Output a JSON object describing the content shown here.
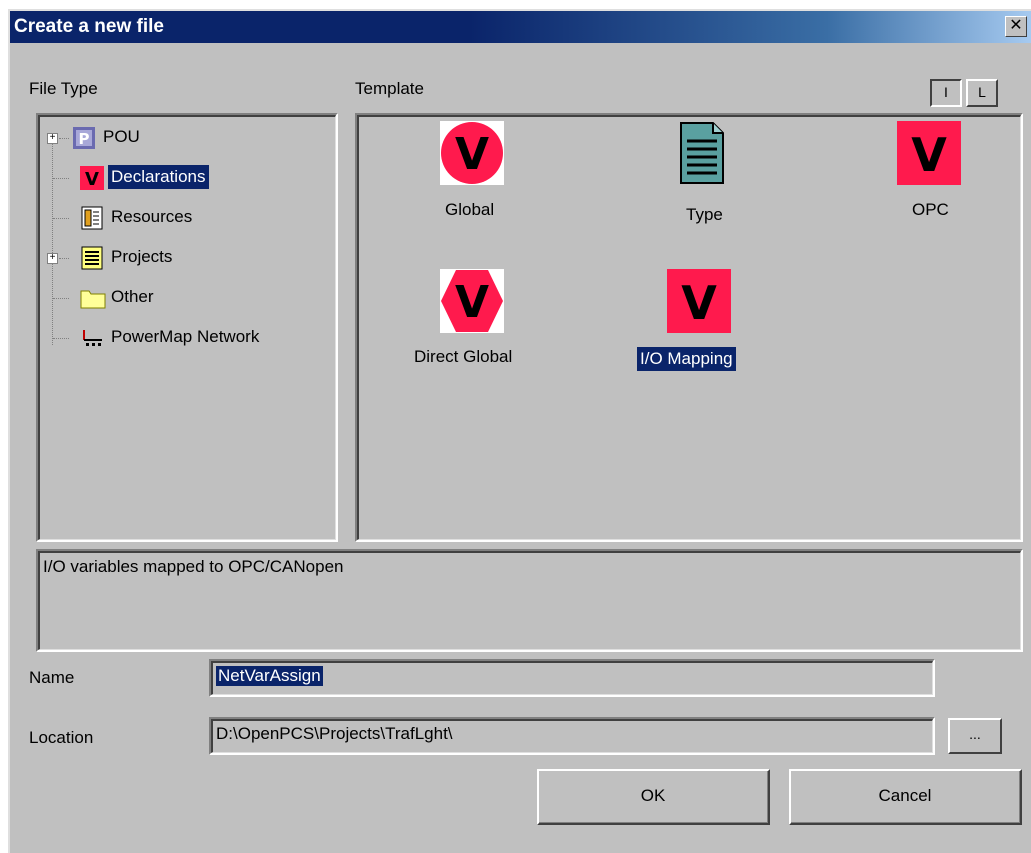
{
  "dialog": {
    "title": "Create a new file",
    "close_glyph": "✕"
  },
  "file_type": {
    "label": "File Type",
    "items": [
      {
        "label": "POU",
        "icon": "pou-icon",
        "expandable": true
      },
      {
        "label": "Declarations",
        "icon": "declarations-icon",
        "selected": true
      },
      {
        "label": "Resources",
        "icon": "resources-icon"
      },
      {
        "label": "Projects",
        "icon": "projects-icon",
        "expandable": true
      },
      {
        "label": "Other",
        "icon": "folder-icon"
      },
      {
        "label": "PowerMap Network",
        "icon": "network-icon"
      }
    ]
  },
  "template": {
    "label": "Template",
    "view_buttons": {
      "icon_view": "I",
      "list_view": "L"
    },
    "items": [
      {
        "label": "Global",
        "icon": "v-circle-icon"
      },
      {
        "label": "Type",
        "icon": "document-icon"
      },
      {
        "label": "OPC",
        "icon": "v-square-icon"
      },
      {
        "label": "Direct Global",
        "icon": "v-hexagon-icon"
      },
      {
        "label": "I/O Mapping",
        "icon": "v-square-icon",
        "selected": true
      }
    ]
  },
  "description": "I/O variables mapped to OPC/CANopen",
  "name": {
    "label": "Name",
    "value": "NetVarAssign"
  },
  "location": {
    "label": "Location",
    "value": "D:\\OpenPCS\\Projects\\TrafLght\\",
    "browse_label": "..."
  },
  "buttons": {
    "ok": "OK",
    "cancel": "Cancel"
  },
  "colors": {
    "title_bar": "#0a246a",
    "selection": "#0a246a",
    "v_icon": "#ff1a4d",
    "dialog_bg": "#c0c0c0"
  }
}
